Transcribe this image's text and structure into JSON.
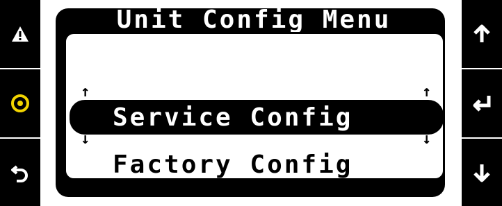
{
  "window": {
    "title": "Unit Config Menu"
  },
  "menu": {
    "items": [
      {
        "label": "Service Config",
        "selected": true
      },
      {
        "label": "Factory Config",
        "selected": false
      }
    ]
  },
  "scroll_indicators": {
    "up": "↑",
    "down": "↓"
  },
  "keys": {
    "left": [
      {
        "name": "alarm-key",
        "icon": "warning-icon"
      },
      {
        "name": "status-key",
        "icon": "target-icon",
        "color": "#f2d400"
      },
      {
        "name": "back-key",
        "icon": "back-arrow-icon"
      }
    ],
    "right": [
      {
        "name": "up-key",
        "icon": "arrow-up-icon"
      },
      {
        "name": "enter-key",
        "icon": "enter-icon"
      },
      {
        "name": "down-key",
        "icon": "arrow-down-icon"
      }
    ]
  },
  "colors": {
    "frame": "#000000",
    "background": "#ffffff",
    "status_icon": "#f2d400"
  }
}
